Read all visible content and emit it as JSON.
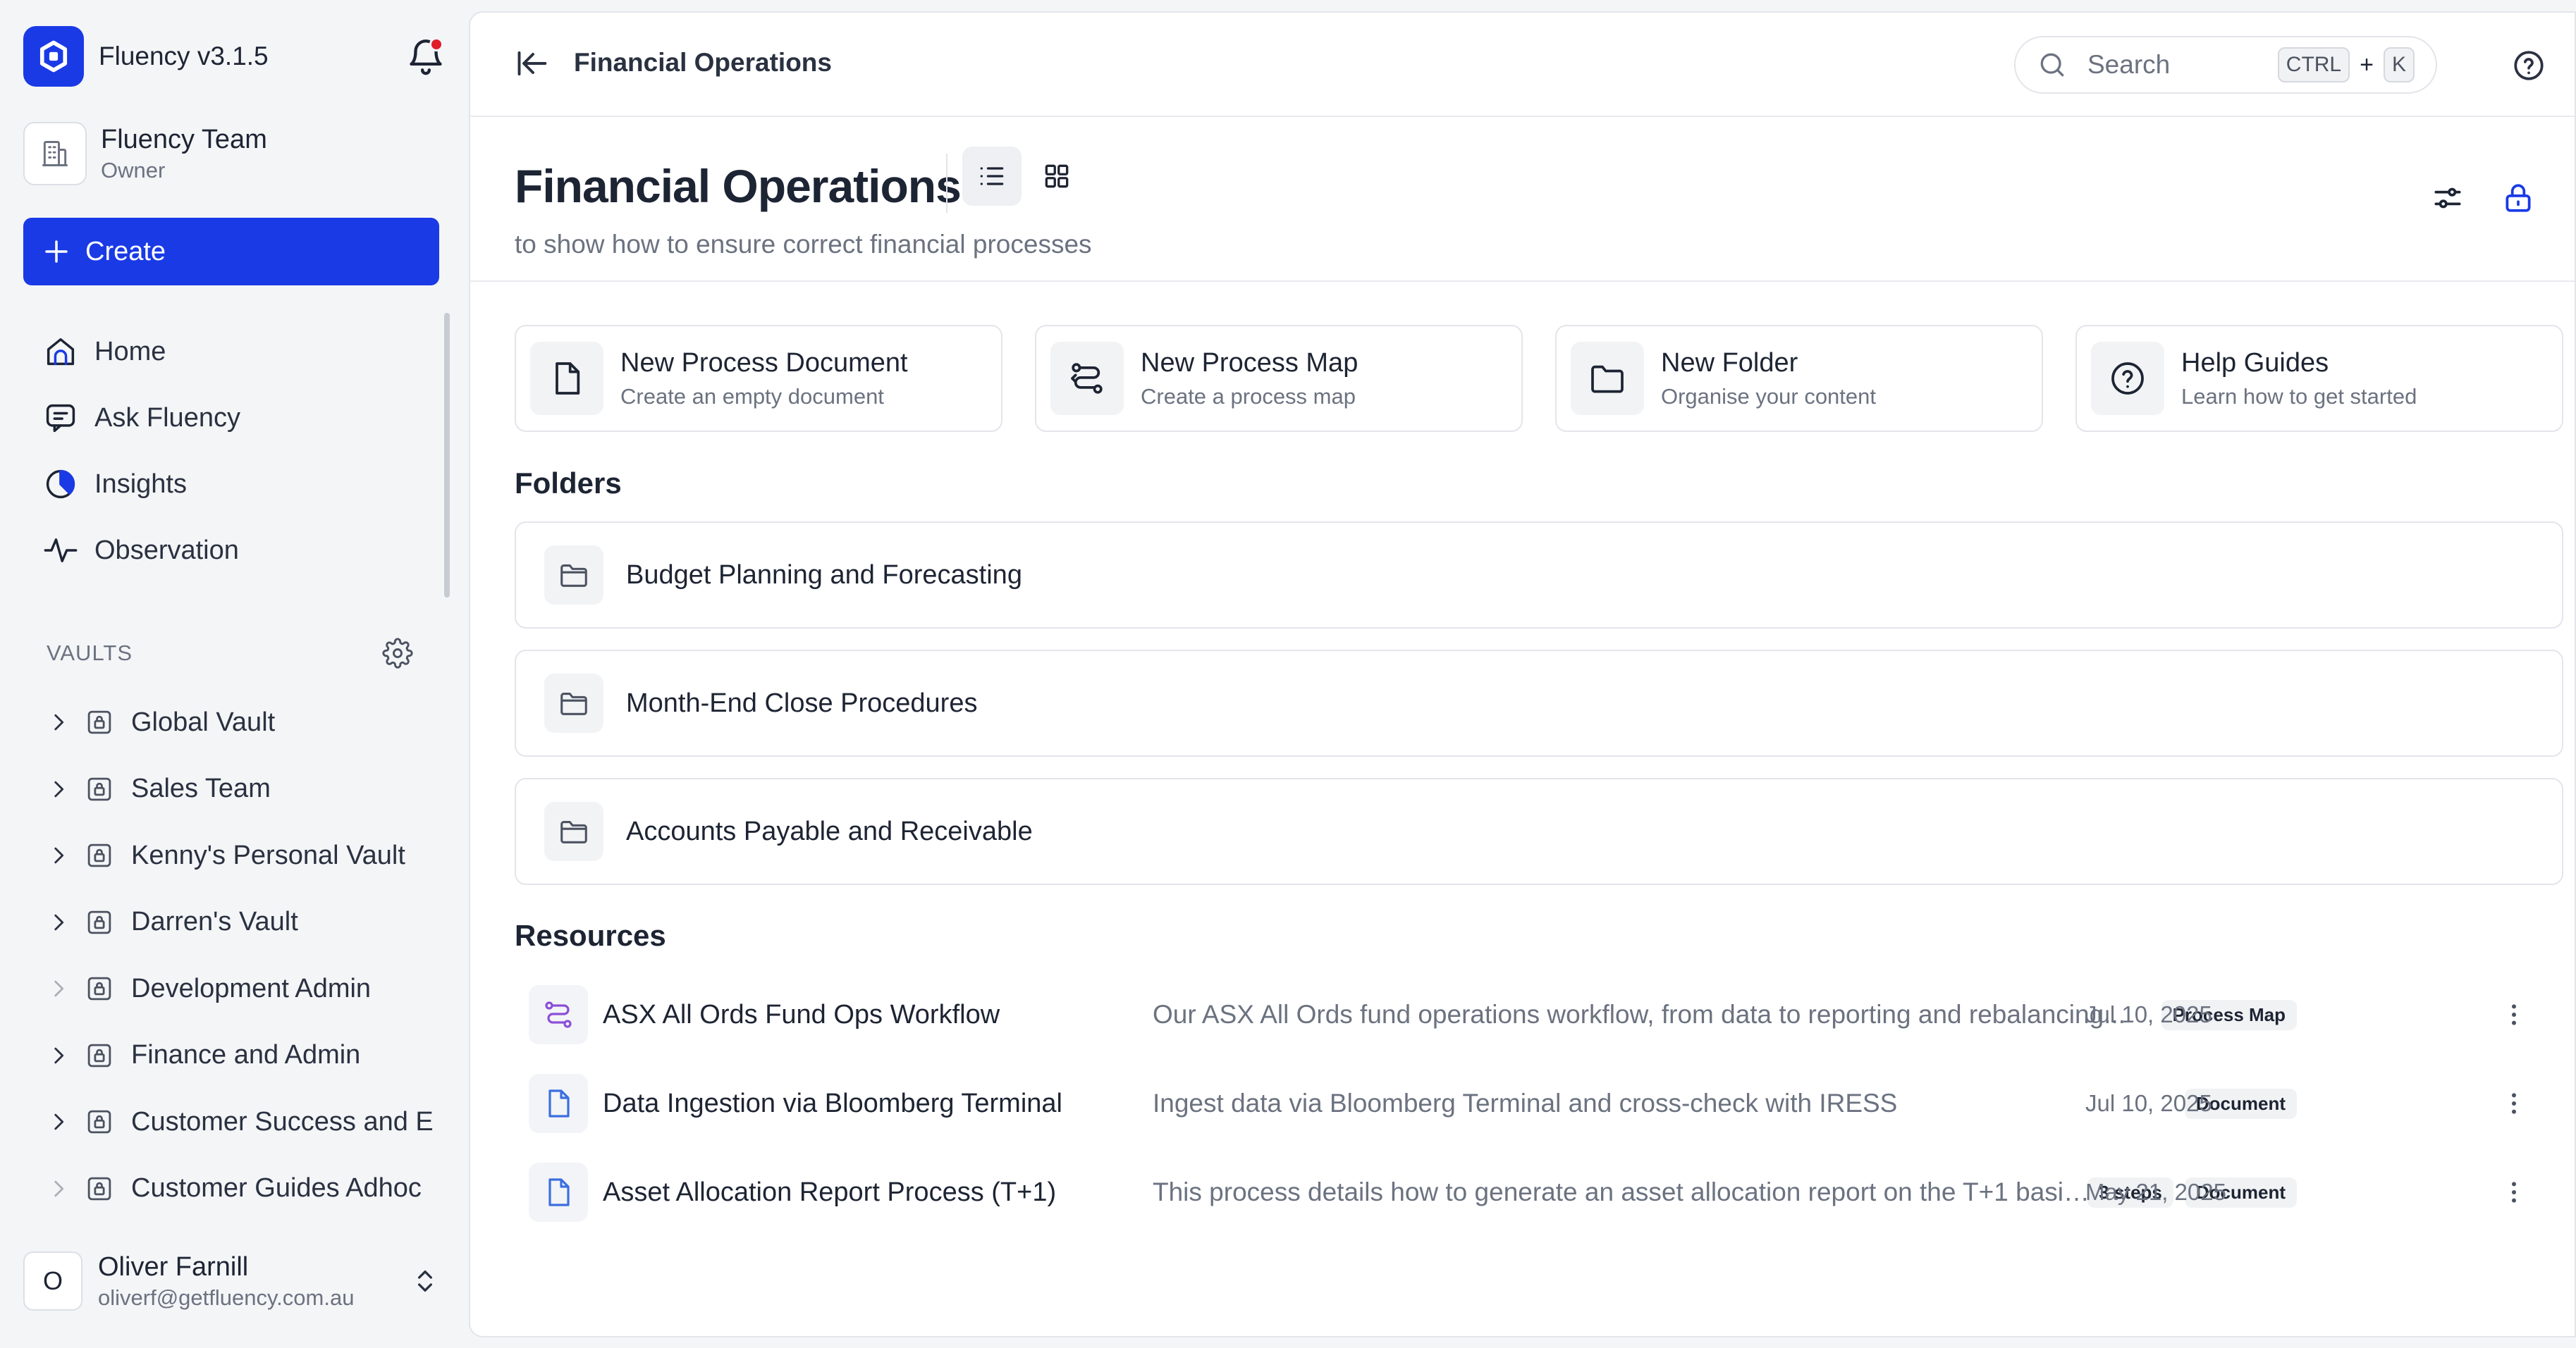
{
  "app": {
    "name": "Fluency v3.1.5",
    "team_name": "Fluency Team",
    "team_role": "Owner",
    "create_label": "Create",
    "brand_color": "#1a3ae6",
    "notification_dot_color": "#e11d2a"
  },
  "sidebar": {
    "nav": [
      {
        "label": "Home",
        "icon": "home-icon"
      },
      {
        "label": "Ask Fluency",
        "icon": "chat-icon"
      },
      {
        "label": "Insights",
        "icon": "pie-chart-icon"
      },
      {
        "label": "Observation",
        "icon": "activity-icon"
      }
    ],
    "vaults_label": "VAULTS",
    "vaults": [
      {
        "label": "Global Vault",
        "expandable": true
      },
      {
        "label": "Sales Team",
        "expandable": true
      },
      {
        "label": "Kenny's Personal Vault",
        "expandable": true
      },
      {
        "label": "Darren's Vault",
        "expandable": true
      },
      {
        "label": "Development Admin",
        "expandable": false
      },
      {
        "label": "Finance and Admin",
        "expandable": true
      },
      {
        "label": "Customer Success and E",
        "expandable": true
      },
      {
        "label": "Customer Guides Adhoc",
        "expandable": false
      }
    ],
    "user": {
      "initial": "O",
      "name": "Oliver Farnill",
      "email": "oliverf@getfluency.com.au"
    }
  },
  "topbar": {
    "breadcrumb": "Financial Operations",
    "search_placeholder": "Search",
    "shortcut_key1": "CTRL",
    "shortcut_plus": "+",
    "shortcut_key2": "K"
  },
  "header": {
    "title": "Financial Operations",
    "subtitle": "to show how to ensure correct financial processes"
  },
  "quick_actions": [
    {
      "title": "New Process Document",
      "subtitle": "Create an empty document",
      "icon": "document-icon"
    },
    {
      "title": "New Process Map",
      "subtitle": "Create a process map",
      "icon": "process-map-icon"
    },
    {
      "title": "New Folder",
      "subtitle": "Organise your content",
      "icon": "folder-icon"
    },
    {
      "title": "Help Guides",
      "subtitle": "Learn how to get started",
      "icon": "help-circle-icon"
    }
  ],
  "folders": {
    "title": "Folders",
    "items": [
      {
        "name": "Budget Planning and Forecasting"
      },
      {
        "name": "Month-End Close Procedures"
      },
      {
        "name": "Accounts Payable and Receivable"
      }
    ]
  },
  "resources": {
    "title": "Resources",
    "items": [
      {
        "name": "ASX All Ords Fund Ops Workflow",
        "description": "Our ASX All Ords fund operations workflow, from data to reporting and rebalancing...",
        "steps": "",
        "type": "Process Map",
        "date": "Jul 10, 2025",
        "icon": "process-map-icon"
      },
      {
        "name": "Data Ingestion via Bloomberg Terminal",
        "description": "Ingest data via Bloomberg Terminal and cross-check with IRESS",
        "steps": "",
        "type": "Document",
        "date": "Jul 10, 2025",
        "icon": "document-icon"
      },
      {
        "name": "Asset Allocation Report Process (T+1)",
        "description": "This process details how to generate an asset allocation report on the T+1 basis...",
        "steps": "3 steps",
        "type": "Document",
        "date": "May 21, 2025",
        "icon": "document-icon"
      }
    ]
  }
}
